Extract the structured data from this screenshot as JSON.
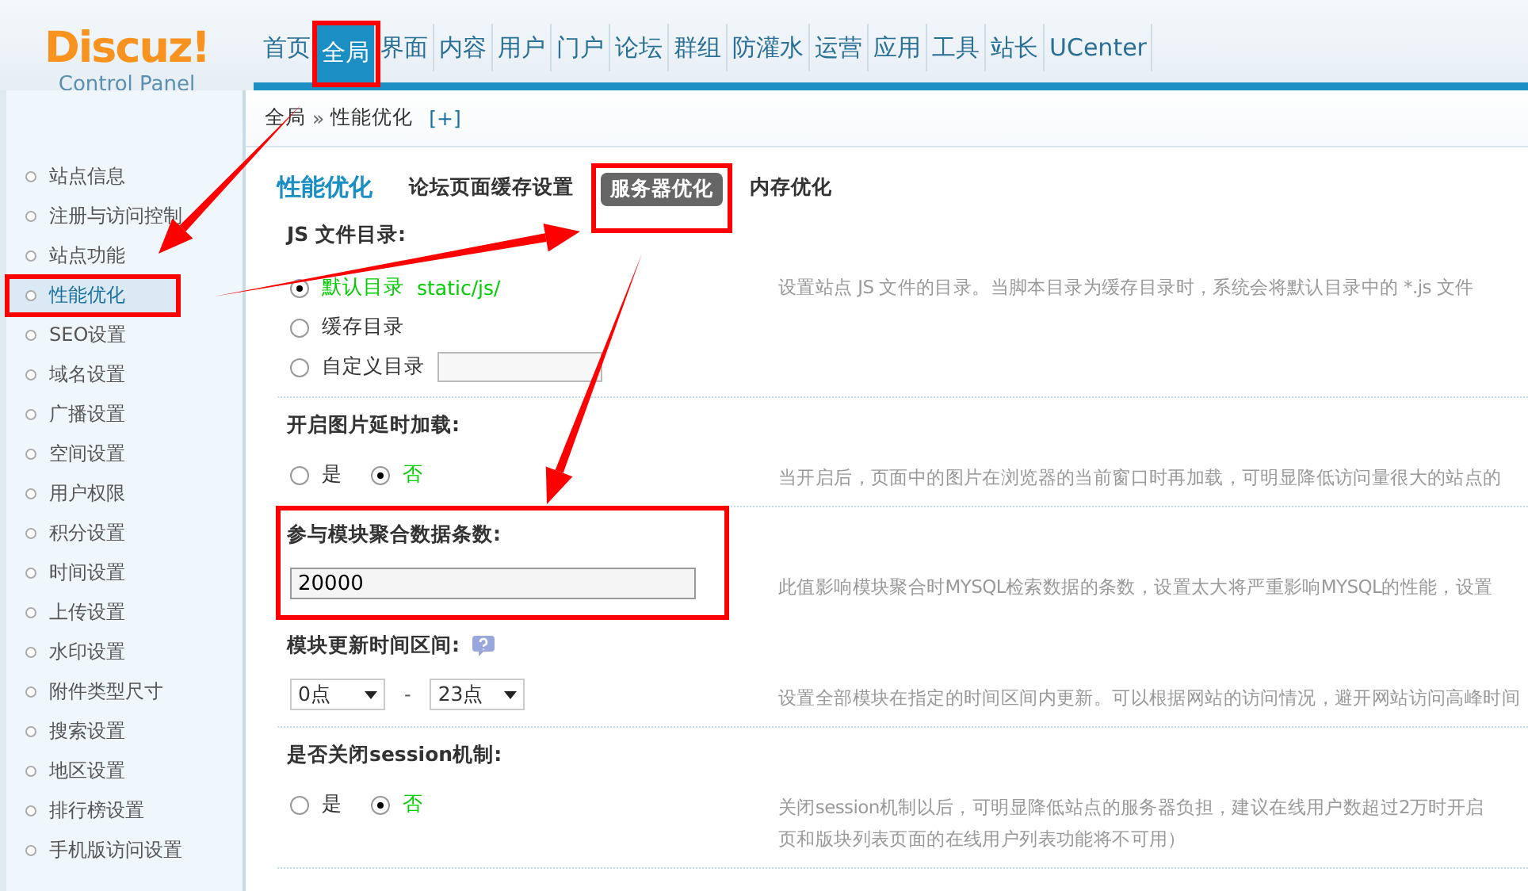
{
  "logo": {
    "name": "Discuz!",
    "subtitle": "Control Panel"
  },
  "nav": [
    {
      "label": "首页",
      "selected": false,
      "highlighted": false
    },
    {
      "label": "全局",
      "selected": true,
      "highlighted": true
    },
    {
      "label": "界面",
      "selected": false,
      "highlighted": false
    },
    {
      "label": "内容",
      "selected": false,
      "highlighted": false
    },
    {
      "label": "用户",
      "selected": false,
      "highlighted": false
    },
    {
      "label": "门户",
      "selected": false,
      "highlighted": false
    },
    {
      "label": "论坛",
      "selected": false,
      "highlighted": false
    },
    {
      "label": "群组",
      "selected": false,
      "highlighted": false
    },
    {
      "label": "防灌水",
      "selected": false,
      "highlighted": false
    },
    {
      "label": "运营",
      "selected": false,
      "highlighted": false
    },
    {
      "label": "应用",
      "selected": false,
      "highlighted": false
    },
    {
      "label": "工具",
      "selected": false,
      "highlighted": false
    },
    {
      "label": "站长",
      "selected": false,
      "highlighted": false
    },
    {
      "label": "UCenter",
      "selected": false,
      "highlighted": false
    }
  ],
  "breadcrumb": {
    "items": [
      "全局",
      "性能优化"
    ],
    "separator": "»",
    "add": "[+]"
  },
  "sidebar": {
    "items": [
      {
        "label": "站点信息",
        "selected": false,
        "highlighted": false
      },
      {
        "label": "注册与访问控制",
        "selected": false,
        "highlighted": false
      },
      {
        "label": "站点功能",
        "selected": false,
        "highlighted": false
      },
      {
        "label": "性能优化",
        "selected": true,
        "highlighted": true
      },
      {
        "label": "SEO设置",
        "selected": false,
        "highlighted": false
      },
      {
        "label": "域名设置",
        "selected": false,
        "highlighted": false
      },
      {
        "label": "广播设置",
        "selected": false,
        "highlighted": false
      },
      {
        "label": "空间设置",
        "selected": false,
        "highlighted": false
      },
      {
        "label": "用户权限",
        "selected": false,
        "highlighted": false
      },
      {
        "label": "积分设置",
        "selected": false,
        "highlighted": false
      },
      {
        "label": "时间设置",
        "selected": false,
        "highlighted": false
      },
      {
        "label": "上传设置",
        "selected": false,
        "highlighted": false
      },
      {
        "label": "水印设置",
        "selected": false,
        "highlighted": false
      },
      {
        "label": "附件类型尺寸",
        "selected": false,
        "highlighted": false
      },
      {
        "label": "搜索设置",
        "selected": false,
        "highlighted": false
      },
      {
        "label": "地区设置",
        "selected": false,
        "highlighted": false
      },
      {
        "label": "排行榜设置",
        "selected": false,
        "highlighted": false
      },
      {
        "label": "手机版访问设置",
        "selected": false,
        "highlighted": false
      }
    ]
  },
  "page_title": "性能优化",
  "tabs": [
    {
      "label": "论坛页面缓存设置",
      "selected": false,
      "highlighted": false
    },
    {
      "label": "服务器优化",
      "selected": true,
      "highlighted": true
    },
    {
      "label": "内存优化",
      "selected": false,
      "highlighted": false
    }
  ],
  "settings": [
    {
      "kind": "radio_list",
      "label": "JS 文件目录:",
      "highlighted": false,
      "options": [
        {
          "label": "默认目录",
          "extra": "static/js/",
          "selected": true
        },
        {
          "label": "缓存目录",
          "selected": false
        },
        {
          "label": "自定义目录",
          "input": true,
          "selected": false
        }
      ],
      "description": [
        "设置站点 JS 文件的目录。当脚本目录为缓存目录时，系统会将默认目录中的 *.js 文件"
      ]
    },
    {
      "kind": "radio_row",
      "label": "开启图片延时加载:",
      "highlighted": false,
      "options": [
        {
          "label": "是",
          "selected": false
        },
        {
          "label": "否",
          "selected": true
        }
      ],
      "description": [
        "当开启后，页面中的图片在浏览器的当前窗口时再加载，可明显降低访问量很大的站点的"
      ]
    },
    {
      "kind": "text_input",
      "label": "参与模块聚合数据条数:",
      "highlighted": true,
      "value": "20000",
      "description": [
        "此值影响模块聚合时MYSQL检索数据的条数，设置太大将严重影响MYSQL的性能，设置"
      ]
    },
    {
      "kind": "time_range",
      "label": "模块更新时间区间:",
      "help": true,
      "highlighted": false,
      "from": "0点",
      "separator": "-",
      "to": "23点",
      "description": [
        "设置全部模块在指定的时间区间内更新。可以根据网站的访问情况，避开网站访问高峰时间"
      ]
    },
    {
      "kind": "radio_row",
      "label": "是否关闭session机制:",
      "highlighted": false,
      "options": [
        {
          "label": "是",
          "selected": false
        },
        {
          "label": "否",
          "selected": true
        }
      ],
      "description": [
        "关闭session机制以后，可明显降低站点的服务器负担，建议在线用户数超过2万时开启",
        "页和版块列表页面的在线用户列表功能将不可用）"
      ]
    }
  ]
}
